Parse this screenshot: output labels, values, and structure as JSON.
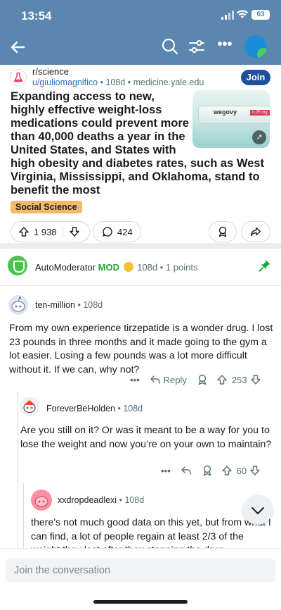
{
  "status": {
    "time": "13:54",
    "battery": "63"
  },
  "nav": {
    "icons": [
      "back-arrow-icon",
      "search-icon",
      "filter-icon",
      "more-icon",
      "avatar"
    ]
  },
  "post": {
    "subreddit": "r/science",
    "author": "u/giuliomagnifico",
    "age": "108d",
    "domain": "medicine.yale.edu",
    "join_label": "Join",
    "title_line1": "Expanding access to new, highly effective weight-loss medications could prevent more than 40,000 deaths a year in the United States, and States with",
    "title_rest": "high obesity and diabetes rates, such as West Virginia, Mississippi, and Oklahoma, stand to benefit the most",
    "thumbnail": {
      "label": "wegovy",
      "dose": "0.25 mg"
    },
    "flair": "Social Science",
    "upvotes": "1 938",
    "comments": "424"
  },
  "automod": {
    "name": "AutoModerator",
    "mod_label": "MOD",
    "meta": "108d • 1 points"
  },
  "comments": [
    {
      "author": "ten-million",
      "age": "108d",
      "body": "From my own experience tirzepatide is a wonder drug. I lost 23 pounds in three months and it made going to the gym a lot easier. Losing a few pounds was a lot more difficult without it. If we can, why not?",
      "reply_label": "Reply",
      "score": "253"
    },
    {
      "author": "ForeverBeHolden",
      "age": "108d",
      "body": "Are you still on it? Or was it meant to be a way for you to lose the weight and now you’re on your own to maintain?",
      "score": "60"
    },
    {
      "author": "xxdropdeadlexi",
      "age": "108d",
      "body": "there's not much good data on this yet, but from what I can find, a lot of people regain at least 2/3 of the weight they lost after they stopping the drug."
    }
  ],
  "composer": {
    "placeholder": "Join the conversation"
  },
  "colors": {
    "header": "#5b86b0",
    "join": "#1e4f9a",
    "flair": "#f3b968",
    "mod": "#1ea839"
  }
}
